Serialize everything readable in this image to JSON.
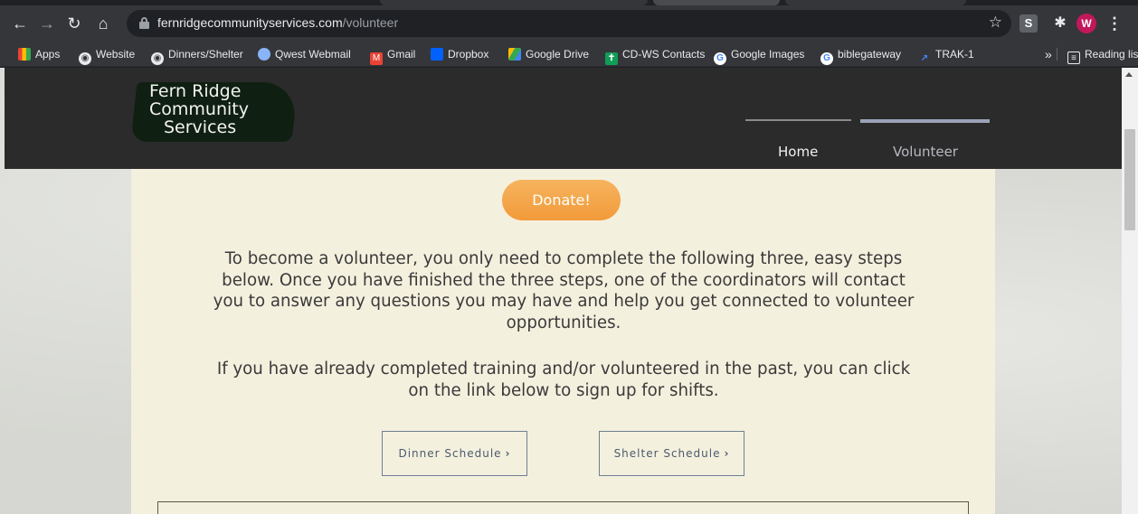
{
  "browser": {
    "url_domain": "fernridgecommunityservices.com",
    "url_path": "/volunteer",
    "avatar_letter": "W",
    "ext_letter": "S",
    "bookmarks": [
      {
        "label": "Apps",
        "icon": "apps-icon"
      },
      {
        "label": "Website",
        "icon": "globe-icon"
      },
      {
        "label": "Dinners/Shelter",
        "icon": "globe-icon"
      },
      {
        "label": "Qwest Webmail",
        "icon": "qwest-icon"
      },
      {
        "label": "Gmail",
        "icon": "gmail-icon"
      },
      {
        "label": "Dropbox",
        "icon": "dropbox-icon"
      },
      {
        "label": "Google Drive",
        "icon": "drive-icon"
      },
      {
        "label": "CD-WS Contacts",
        "icon": "contacts-icon"
      },
      {
        "label": "Google Images",
        "icon": "google-icon"
      },
      {
        "label": "biblegateway",
        "icon": "google-icon"
      },
      {
        "label": "TRAK-1",
        "icon": "trak-icon"
      }
    ],
    "overflow_label": "»",
    "reading_list": "Reading list"
  },
  "site": {
    "logo": [
      "Fern Ridge",
      "Community",
      "Services"
    ],
    "nav": [
      {
        "label": "Home",
        "active": false
      },
      {
        "label": "Volunteer",
        "active": true
      }
    ],
    "donate_label": "Donate!",
    "intro_text": "To become a volunteer, you only need to complete the following three, easy steps below. Once you have finished the three steps, one of the coordinators will contact you to answer any questions you may have and help you get connected to volunteer opportunities.",
    "returning_text": "If you have already completed training and/or volunteered in the past, you can click on the link below to sign up for shifts.",
    "buttons": {
      "dinner": "Dinner Schedule",
      "shelter": "Shelter Schedule"
    }
  },
  "colors": {
    "header_bg": "#2b2b2b",
    "panel_bg": "#f4f0de",
    "donate_orange": "#f29a3a",
    "button_border": "#6e7f92"
  }
}
